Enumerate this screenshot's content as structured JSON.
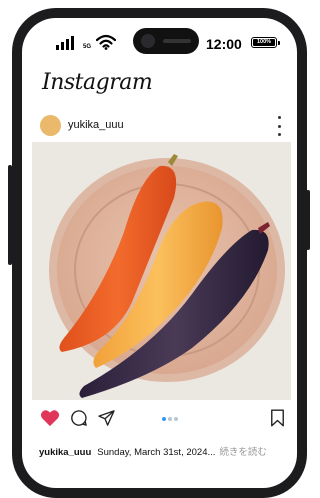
{
  "status_bar": {
    "network": "5G",
    "time": "12:00",
    "battery": "100%"
  },
  "app": {
    "name": "Instagram"
  },
  "post": {
    "username": "yukika_uuu",
    "image_alt": "Three carrots (orange, yellow, purple) on a wooden plate",
    "liked": true,
    "carousel": {
      "count": 3,
      "active": 1
    },
    "caption_user": "yukika_uuu",
    "caption_text": "Sunday, March 31st, 2024...",
    "read_more": "続きを読む"
  },
  "colors": {
    "like": "#e0365a",
    "carousel_active": "#3897f0",
    "avatar": "#eab96b"
  },
  "icons": [
    "signal-icon",
    "wifi-icon",
    "battery-icon",
    "more-icon",
    "heart-icon",
    "comment-icon",
    "share-icon",
    "bookmark-icon"
  ]
}
